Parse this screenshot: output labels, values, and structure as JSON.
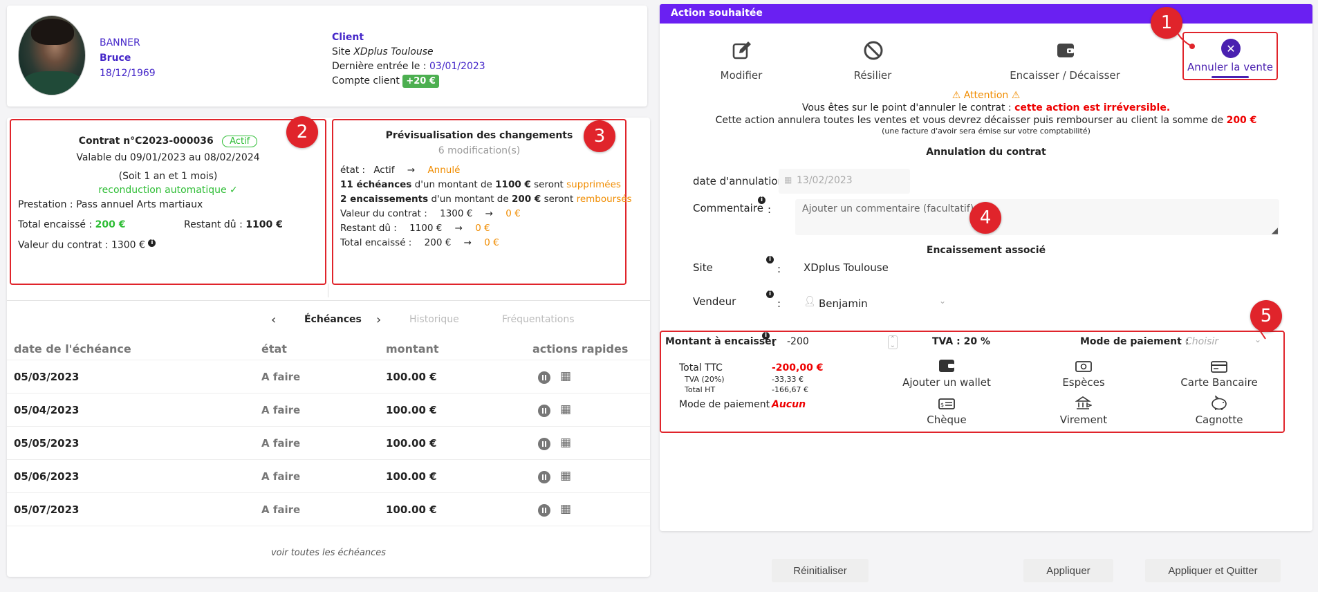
{
  "client": {
    "last_name": "BANNER",
    "first_name": "Bruce",
    "birth_date": "18/12/1969",
    "title": "Client",
    "site_label": "Site",
    "site_name": "XDplus Toulouse",
    "last_entry_label": "Dernière entrée le :",
    "last_entry_date": "03/01/2023",
    "account_label": "Compte client",
    "account_balance": "+20 €"
  },
  "annotations": [
    "1",
    "2",
    "3",
    "4",
    "5"
  ],
  "contract": {
    "title": "Contrat n°C2023-000036",
    "status": "Actif",
    "validity": "Valable du 09/01/2023 au 08/02/2024",
    "duration": "(Soit 1 an et 1 mois)",
    "renewal": "reconduction automatique ✓",
    "prestation_label": "Prestation :",
    "prestation_value": "Pass annuel Arts martiaux",
    "total_label": "Total encaissé :",
    "total_value": "200 €",
    "remaining_label": "Restant dû :",
    "remaining_value": "1100 €",
    "value_label": "Valeur du contrat :",
    "value_value": "1300 €"
  },
  "preview": {
    "title": "Prévisualisation des changements",
    "count": "6 modification(s)",
    "state_label": "état :",
    "state_from": "Actif",
    "state_to": "Annulé",
    "line1_bold": "11 échéances",
    "line1_mid": "d'un montant de",
    "line1_amount": "1100 €",
    "line1_verb": "seront",
    "line1_action": "supprimées",
    "line2_bold": "2 encaissements",
    "line2_mid": "d'un montant de",
    "line2_amount": "200 €",
    "line2_verb": "seront",
    "line2_action": "remboursés",
    "value_label": "Valeur du contrat :",
    "value_from": "1300 €",
    "value_to": "0 €",
    "remaining_label": "Restant dû :",
    "remaining_from": "1100 €",
    "remaining_to": "0 €",
    "total_label": "Total encaissé :",
    "total_from": "200 €",
    "total_to": "0 €",
    "arrow": "→"
  },
  "tabs": {
    "prev": "‹",
    "next": "›",
    "active": "Échéances",
    "history": "Historique",
    "attendance": "Fréquentations"
  },
  "table": {
    "headers": [
      "date de l'échéance",
      "état",
      "montant",
      "actions rapides"
    ],
    "rows": [
      {
        "date": "05/03/2023",
        "state": "A faire",
        "amount": "100.00 €"
      },
      {
        "date": "05/04/2023",
        "state": "A faire",
        "amount": "100.00 €"
      },
      {
        "date": "05/05/2023",
        "state": "A faire",
        "amount": "100.00 €"
      },
      {
        "date": "05/06/2023",
        "state": "A faire",
        "amount": "100.00 €"
      },
      {
        "date": "05/07/2023",
        "state": "A faire",
        "amount": "100.00 €"
      }
    ],
    "see_all": "voir toutes les échéances"
  },
  "action_panel": {
    "header": "Action souhaitée",
    "actions": [
      {
        "label": "Modifier",
        "icon": "edit-icon"
      },
      {
        "label": "Résilier",
        "icon": "ban-icon"
      },
      {
        "label": "Encaisser / Décaisser",
        "icon": "wallet-icon"
      },
      {
        "label": "Annuler la vente",
        "icon": "close-circle-icon"
      }
    ],
    "attention": "⚠ Attention ⚠",
    "msg1_start": "Vous êtes sur le point d'annuler le contrat :",
    "msg1_warn": "cette action est irréversible.",
    "msg2_start": "Cette action annulera toutes les ventes et vous devrez décaisser puis rembourser au client la somme de",
    "msg2_amount": "200 €",
    "msg3": "(une facture d'avoir sera émise sur votre comptabilité)",
    "cancel_section": "Annulation du contrat",
    "cancel_date_label": "date d'annulation :",
    "cancel_date_value": "13/02/2023",
    "comment_label": "Commentaire",
    "comment_placeholder": "Ajouter un commentaire (facultatif)",
    "payment_section": "Encaissement associé",
    "site_label": "Site",
    "site_value": "XDplus Toulouse",
    "seller_label": "Vendeur",
    "seller_value": "Benjamin",
    "amount_label": "Montant à encaisser",
    "amount_value": "-200",
    "tva_label": "TVA : 20 %",
    "mode_label": "Mode de paiement :",
    "mode_placeholder": "Choisir",
    "ttc_label": "Total TTC",
    "ttc_value": "-200,00 €",
    "tva_line_label": "TVA (20%)",
    "tva_line_value": "-33,33 €",
    "ht_label": "Total HT",
    "ht_value": "-166,67 €",
    "mode_summary_label": "Mode de paiement",
    "mode_summary_value": "Aucun",
    "payment_methods": [
      {
        "label": "Ajouter un wallet",
        "icon": "wallet-icon"
      },
      {
        "label": "Espèces",
        "icon": "cash-icon"
      },
      {
        "label": "Carte Bancaire",
        "icon": "credit-card-icon"
      },
      {
        "label": "Chèque",
        "icon": "cheque-icon"
      },
      {
        "label": "Virement",
        "icon": "bank-transfer-icon"
      },
      {
        "label": "Cagnotte",
        "icon": "piggy-bank-icon"
      }
    ],
    "colon": ":"
  },
  "buttons": {
    "reset": "Réinitialiser",
    "apply": "Appliquer",
    "apply_quit": "Appliquer et Quitter"
  }
}
